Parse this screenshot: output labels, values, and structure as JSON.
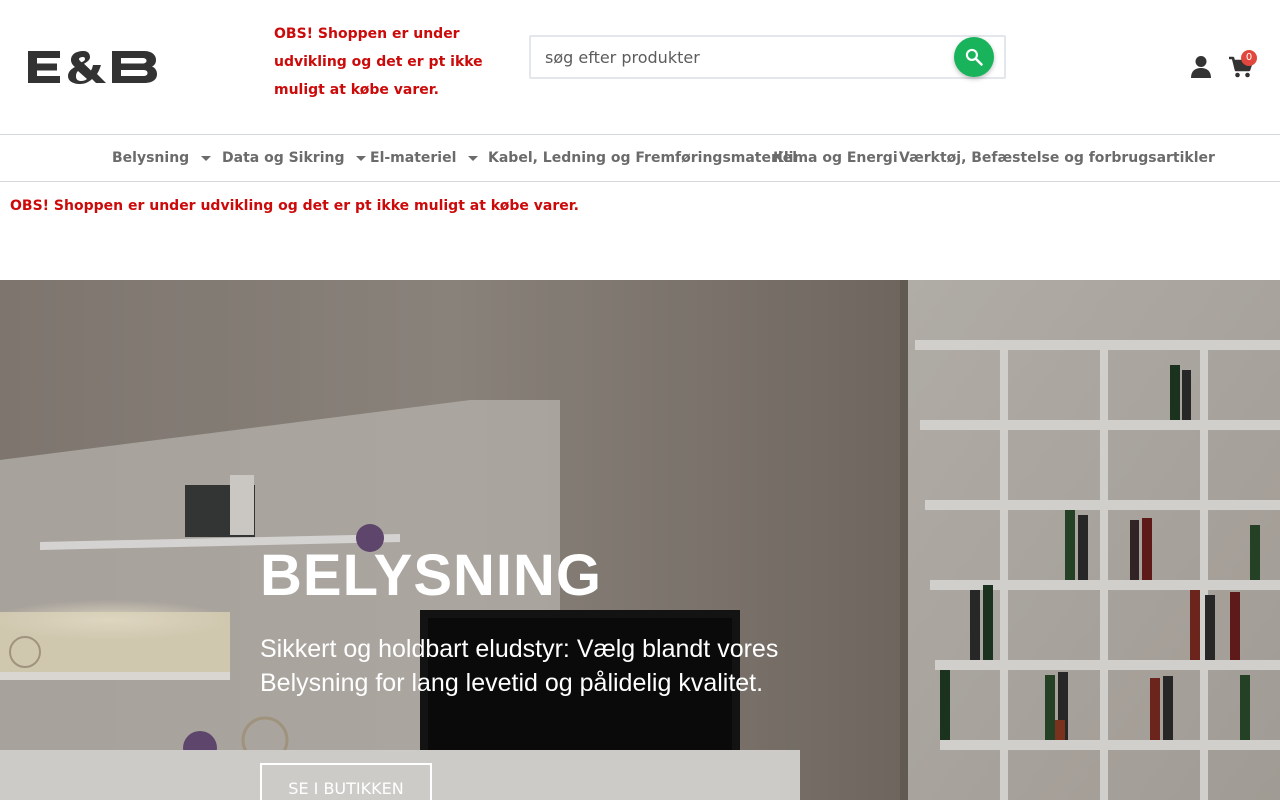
{
  "header": {
    "logo_text": "E&B",
    "notice": "OBS! Shoppen er under udvikling og det er pt ikke muligt at købe varer.",
    "search": {
      "placeholder": "søg efter produkter",
      "value": ""
    },
    "cart_count": "0",
    "search_button_color": "#19b35b"
  },
  "nav": {
    "items": [
      {
        "label": "Belysning",
        "has_dropdown": true
      },
      {
        "label": "Data og Sikring",
        "has_dropdown": true
      },
      {
        "label": "El-materiel",
        "has_dropdown": true
      },
      {
        "label": "Kabel, Ledning og Fremføringsmateriel",
        "has_dropdown": false
      },
      {
        "label": "Klima og Energi",
        "has_dropdown": false
      },
      {
        "label": "Værktøj, Befæstelse og forbrugsartikler",
        "has_dropdown": false
      }
    ]
  },
  "page_notice": "OBS! Shoppen er under udvikling og det er pt ikke muligt at købe varer.",
  "hero": {
    "title": "BELYSNING",
    "text": "Sikkert og holdbart eludstyr: Vælg blandt vores Belysning for lang levetid og pålidelig kvalitet.",
    "button_label": "SE I BUTIKKEN"
  },
  "colors": {
    "notice_red": "#cc0a0a",
    "accent_green": "#19b35b",
    "badge_red": "#e0483e"
  },
  "icons": [
    "search-icon",
    "user-icon",
    "cart-icon",
    "chevron-down-icon"
  ]
}
